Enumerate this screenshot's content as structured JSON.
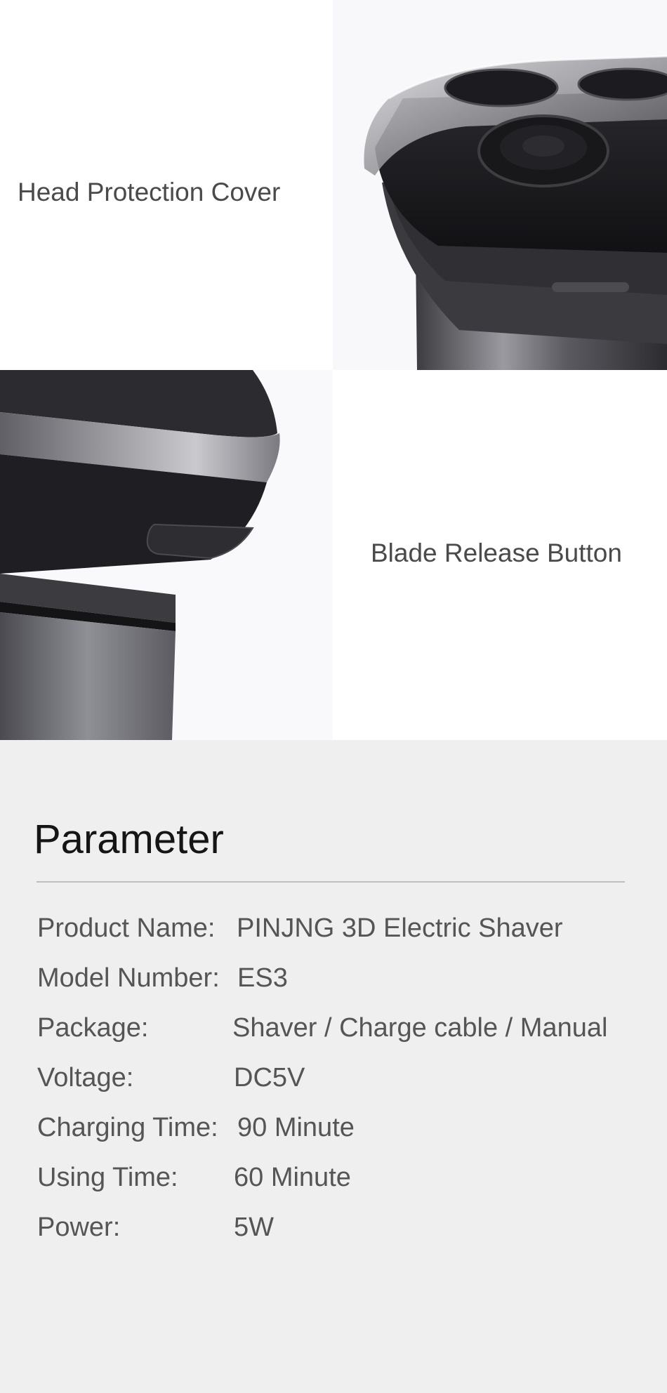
{
  "features": [
    {
      "label": "Head Protection Cover",
      "icon": "shaver-head-with-cover-image"
    },
    {
      "label": "Blade Release Button",
      "icon": "shaver-side-release-button-image"
    }
  ],
  "parameters": {
    "title": "Parameter",
    "rows": [
      {
        "key": "Product Name:",
        "value": "PINJNG 3D Electric Shaver"
      },
      {
        "key": "Model Number:",
        "value": "ES3"
      },
      {
        "key": "Package:",
        "value": "Shaver / Charge cable / Manual"
      },
      {
        "key": "Voltage:",
        "value": "DC5V"
      },
      {
        "key": "Charging Time:",
        "value": "90 Minute"
      },
      {
        "key": "Using Time:",
        "value": "60 Minute"
      },
      {
        "key": "Power:",
        "value": "5W"
      }
    ]
  },
  "colors": {
    "section_background": "#efefef",
    "label_text": "#4a4a4a",
    "title_text": "#151515",
    "divider": "#bdbdbd"
  }
}
